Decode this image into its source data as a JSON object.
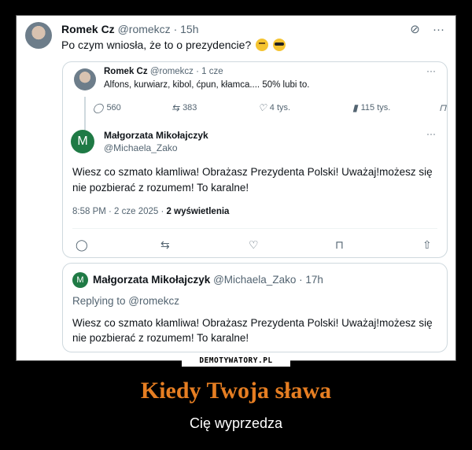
{
  "tweet": {
    "author_name": "Romek Cz",
    "author_handle": "@romekcz",
    "time": "· 15h",
    "text": "Po czym wniosła, że to o prezydencie?",
    "icons": [
      "no-notifications-icon",
      "more-icon"
    ],
    "more": "···",
    "notif_icon": "⊘"
  },
  "quoted": {
    "author_name": "Romek Cz",
    "author_handle": "@romekcz",
    "time": "· 1 cze",
    "text": "Alfons, kurwiarz, kibol, ćpun, kłamca.... 50% lubi to.",
    "more": "···",
    "stats": {
      "replies": "560",
      "reposts": "383",
      "likes": "4 tys.",
      "views": "115 tys."
    }
  },
  "reply": {
    "avatar_letter": "M",
    "author_name": "Małgorzata Mikołajczyk",
    "author_handle": "@Michaela_Zako",
    "more": "···",
    "text": "Wiesz co szmato kłamliwa! Obrażasz Prezydenta Polski! Uważaj!możesz się nie pozbierać z rozumem! To karalne!",
    "timestamp": "8:58 PM · 2 cze 2025 · ",
    "views": "2 wyświetlenia"
  },
  "reply2": {
    "avatar_letter": "M",
    "author_name": "Małgorzata Mikołajczyk",
    "author_handle": "@Michaela_Zako",
    "time": "· 17h",
    "replying_to": "Replying to @romekcz",
    "text": "Wiesz co szmato kłamliwa! Obrażasz Prezydenta Polski! Uważaj!możesz się nie pozbierać z rozumem! To karalne!"
  },
  "watermark": "DEMOTYWATORY.PL",
  "caption": {
    "title": "Kiedy Twoja sława",
    "subtitle": "Cię wyprzedza"
  },
  "colors": {
    "title": "#e67e22",
    "avatar_green": "#1f7a45",
    "muted_text": "#536471"
  }
}
